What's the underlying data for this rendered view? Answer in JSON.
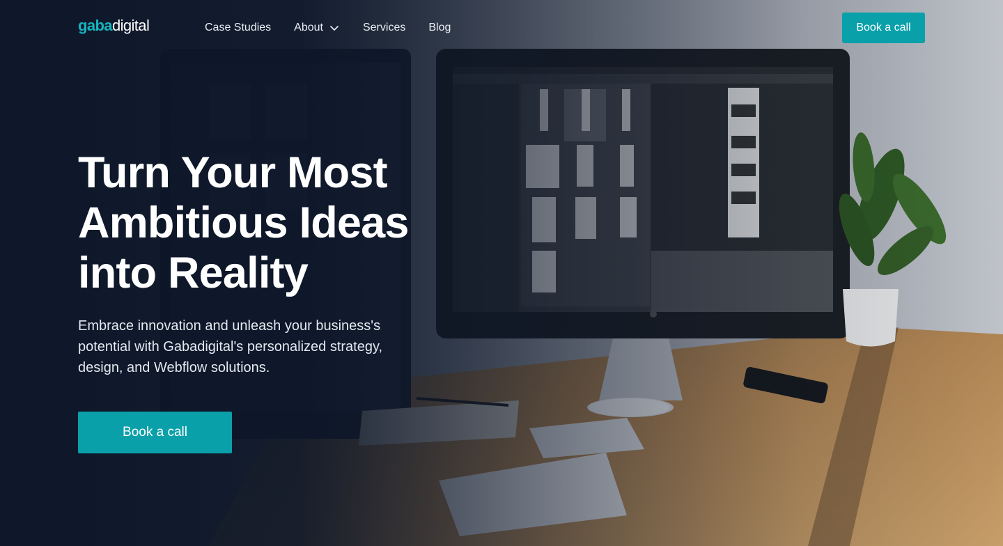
{
  "brand": {
    "logo_part1": "gaba",
    "logo_part2": "digital",
    "accent": "#0aa0aa",
    "logo_accent": "#16b3bd"
  },
  "nav": {
    "links": [
      {
        "label": "Case Studies"
      },
      {
        "label": "About",
        "icon": "chevron-down-icon"
      },
      {
        "label": "Services"
      },
      {
        "label": "Blog"
      }
    ],
    "cta_label": "Book a call"
  },
  "hero": {
    "headline": "Turn Your Most Ambitious Ideas into Reality",
    "subtext": "Embrace innovation and unleash your business's potential with Gabadigital's personalized strategy, design, and Webflow solutions.",
    "cta_label": "Book a call",
    "background_image": "desk-with-imac-keyboard-phone-and-plant"
  }
}
